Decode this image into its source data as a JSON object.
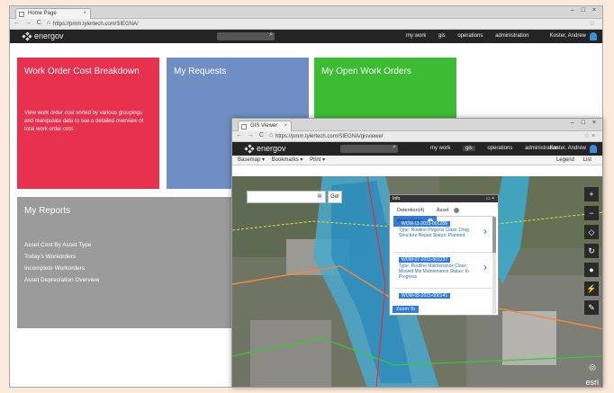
{
  "back_window": {
    "tab_title": "Home Page",
    "tab_close": "×",
    "window_controls": "– □ ×",
    "nav": "← → C ⌂",
    "url": "https://pmm.tylertech.com/SIEGNA/",
    "star": "☆",
    "logo_text": "energov",
    "search_icon": "⌕",
    "menu": [
      "my work",
      "gis",
      "operations",
      "administration"
    ],
    "user": "Koster, Andrew"
  },
  "tiles": {
    "work_order_cost": {
      "title": "Work Order Cost Breakdown",
      "description": "View work order cost sorted by various groupings and manipulate data to see a detailed overview of total work order cost.",
      "color": "#e8304f"
    },
    "my_requests": {
      "title": "My Requests",
      "color": "#6f8fc4"
    },
    "my_open_work_orders": {
      "title": "My Open Work Orders",
      "color": "#3cbc32"
    },
    "my_reports": {
      "title": "My Reports",
      "items": [
        "Asset Cost By Asset Type",
        "Today's Workorders",
        "Incomplete Workorders",
        "Asset Depreciation Overview"
      ],
      "color": "#9b9b9b"
    }
  },
  "front_window": {
    "tab_title": "GIS Viewer",
    "tab_close": "×",
    "window_controls": "– □ ×",
    "nav": "← → C ⌂",
    "url": "https://pmm.tylertech.com/SIEGNA/gisviewer",
    "star": "☆ ≡",
    "logo_text": "energov",
    "search_icon": "⌕",
    "menu": [
      "my work",
      "gis",
      "operations",
      "administration"
    ],
    "user": "Koster, Andrew",
    "toolbar": {
      "basemap": "Basemap ▾",
      "bookmarks": "Bookmarks ▾",
      "print": "Print ▾",
      "legend": "Legend",
      "list": "List"
    },
    "map_search": {
      "clear": "⊗",
      "go": "Go!"
    },
    "map_tools": [
      "+",
      "−",
      "◇",
      "↻",
      "●",
      "⚡",
      "✎"
    ],
    "compass": "◎",
    "esri": "esri",
    "panel": {
      "header": "Info",
      "header_close": "▭ ×",
      "tabs": [
        {
          "label": "Detention(4)",
          "count": ""
        },
        {
          "label": "Asset",
          "count": "1"
        },
        {
          "label": "Work Order",
          "count": "3"
        }
      ],
      "cards": [
        {
          "id": "WOM-11-2015-001289",
          "text": "Type: Routine Projects Class: Drag Structure Repair Status: Planned"
        },
        {
          "id": "WOM-07-2015-001237",
          "text": "Type: Routine Maintenance Class: Mowed Mix Maintenance Status: In Progress"
        },
        {
          "id": "WOM-05-2015-000141",
          "text": ""
        }
      ],
      "chevron": "›",
      "zoom_to": "Zoom To"
    }
  }
}
